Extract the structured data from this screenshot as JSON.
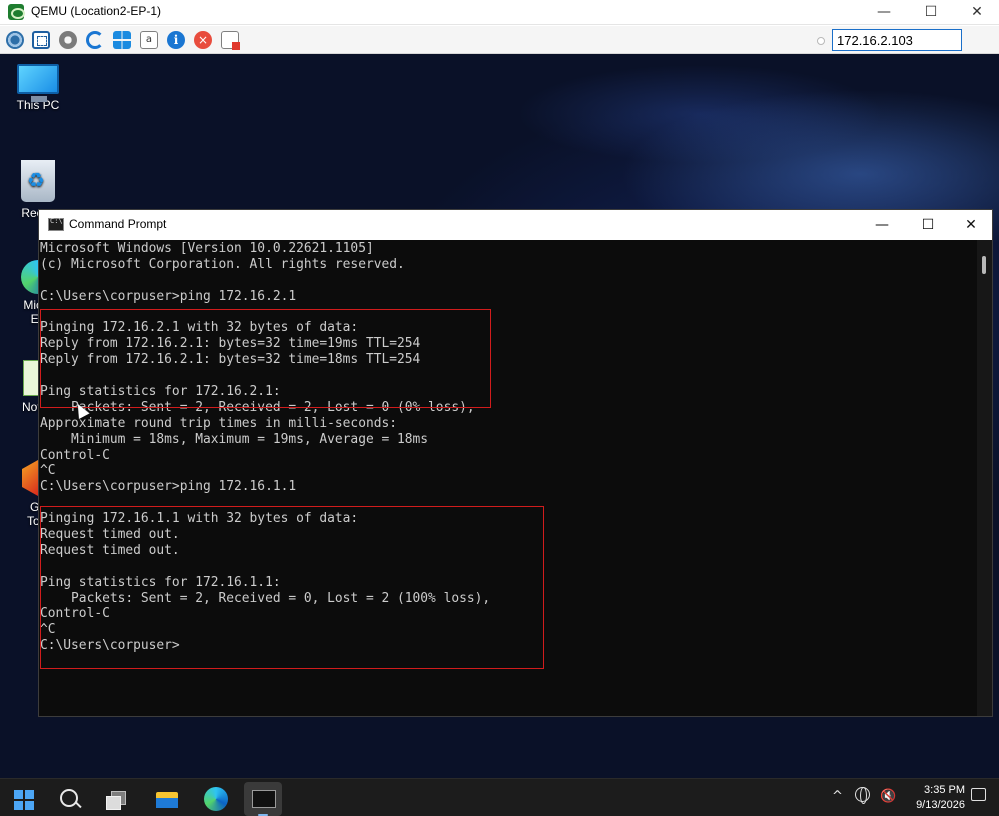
{
  "qemu": {
    "title": "QEMU (Location2-EP-1)",
    "controls": {
      "minimize": "—",
      "maximize": "☐",
      "close": "✕"
    },
    "address_value": "172.16.2.103",
    "toolbar": {
      "text_icon": "a",
      "info_icon": "i",
      "stop_icon": "×"
    }
  },
  "desktop": {
    "icons": [
      {
        "label": "This PC",
        "icon": "monitor-icon"
      },
      {
        "label": "Recyc",
        "icon": "recycle-bin-icon"
      },
      {
        "label": "Micro",
        "label2": "Ed",
        "icon": "edge-icon"
      },
      {
        "label": "Notep",
        "icon": "notepad-icon"
      },
      {
        "label": "Gh",
        "label2": "Tool",
        "icon": "ghidra-icon"
      }
    ]
  },
  "cmd": {
    "title": "Command Prompt",
    "controls": {
      "minimize": "—",
      "maximize": "☐",
      "close": "✕"
    },
    "lines": [
      "Microsoft Windows [Version 10.0.22621.1105]",
      "(c) Microsoft Corporation. All rights reserved.",
      "",
      "C:\\Users\\corpuser>ping 172.16.2.1",
      "",
      "Pinging 172.16.2.1 with 32 bytes of data:",
      "Reply from 172.16.2.1: bytes=32 time=19ms TTL=254",
      "Reply from 172.16.2.1: bytes=32 time=18ms TTL=254",
      "",
      "Ping statistics for 172.16.2.1:",
      "    Packets: Sent = 2, Received = 2, Lost = 0 (0% loss),",
      "Approximate round trip times in milli-seconds:",
      "    Minimum = 18ms, Maximum = 19ms, Average = 18ms",
      "Control-C",
      "^C",
      "C:\\Users\\corpuser>ping 172.16.1.1",
      "",
      "Pinging 172.16.1.1 with 32 bytes of data:",
      "Request timed out.",
      "Request timed out.",
      "",
      "Ping statistics for 172.16.1.1:",
      "    Packets: Sent = 2, Received = 0, Lost = 2 (100% loss),",
      "Control-C",
      "^C",
      "C:\\Users\\corpuser>"
    ]
  },
  "taskbar": {
    "tray_chevron": "^",
    "volume_icon": "🔇",
    "time": "3:35 PM",
    "date": "9/13/2026"
  },
  "colors": {
    "console_bg": "#0c0c0c",
    "console_text": "#cccccc",
    "highlight": "#d11c1c",
    "accent": "#1a76d2"
  }
}
